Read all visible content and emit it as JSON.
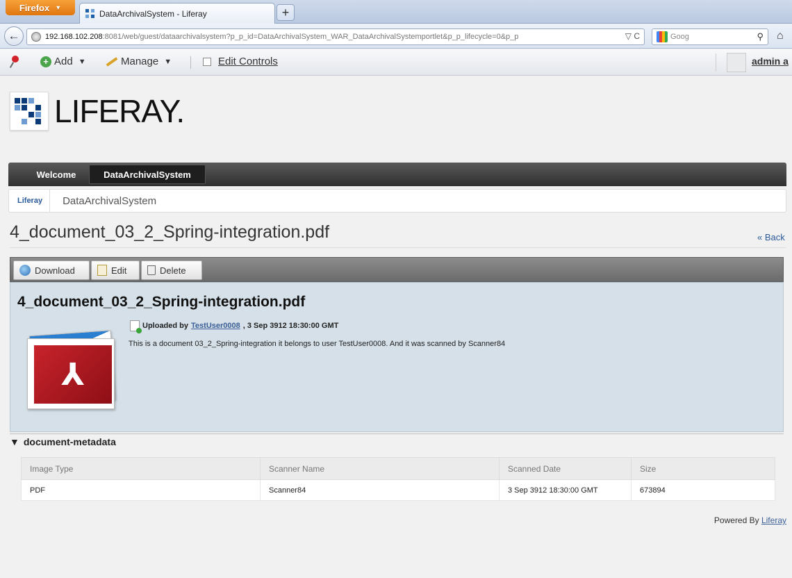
{
  "browser": {
    "app_button": "Firefox",
    "tab_title": "DataArchivalSystem - Liferay",
    "new_tab": "+",
    "url_host": "192.168.102.208",
    "url_rest": ":8081/web/guest/dataarchivalsystem?p_p_id=DataArchivalSystem_WAR_DataArchivalSystemportlet&p_p_lifecycle=0&p_p",
    "url_right": "▽ C",
    "search_placeholder": "Goog"
  },
  "dockbar": {
    "add_label": "Add",
    "manage_label": "Manage",
    "edit_controls_label": "Edit Controls",
    "user_label": "admin a"
  },
  "site": {
    "logo_text": "LIFERAY.",
    "nav_tabs": [
      "Welcome",
      "DataArchivalSystem"
    ],
    "breadcrumb_home": "Liferay",
    "breadcrumb_current": "DataArchivalSystem"
  },
  "document": {
    "title": "4_document_03_2_Spring-integration.pdf",
    "back_label": "« Back",
    "toolbar": {
      "download": "Download",
      "edit": "Edit",
      "delete": "Delete"
    },
    "uploaded_prefix": "Uploaded by",
    "uploader": "TestUser0008",
    "uploaded_suffix": ", 3 Sep 3912 18:30:00 GMT",
    "description": "This is a document 03_2_Spring-integration it belongs to user TestUser0008. And it was scanned by Scanner84"
  },
  "metadata": {
    "section_label": "document-metadata",
    "columns": [
      "Image Type",
      "Scanner Name",
      "Scanned Date",
      "Size"
    ],
    "rows": [
      [
        "PDF",
        "Scanner84",
        "3 Sep 3912 18:30:00 GMT",
        "673894"
      ]
    ]
  },
  "footer": {
    "powered_prefix": "Powered By",
    "powered_link": "Liferay"
  }
}
